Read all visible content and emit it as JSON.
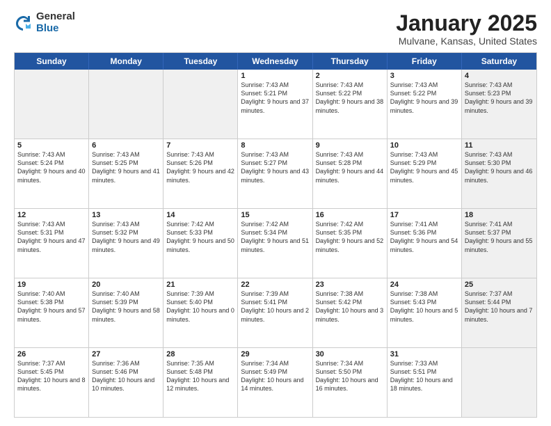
{
  "logo": {
    "general": "General",
    "blue": "Blue"
  },
  "title": "January 2025",
  "subtitle": "Mulvane, Kansas, United States",
  "header_days": [
    "Sunday",
    "Monday",
    "Tuesday",
    "Wednesday",
    "Thursday",
    "Friday",
    "Saturday"
  ],
  "weeks": [
    [
      {
        "day": "",
        "info": "",
        "shaded": true
      },
      {
        "day": "",
        "info": "",
        "shaded": true
      },
      {
        "day": "",
        "info": "",
        "shaded": true
      },
      {
        "day": "1",
        "info": "Sunrise: 7:43 AM\nSunset: 5:21 PM\nDaylight: 9 hours and 37 minutes."
      },
      {
        "day": "2",
        "info": "Sunrise: 7:43 AM\nSunset: 5:22 PM\nDaylight: 9 hours and 38 minutes."
      },
      {
        "day": "3",
        "info": "Sunrise: 7:43 AM\nSunset: 5:22 PM\nDaylight: 9 hours and 39 minutes."
      },
      {
        "day": "4",
        "info": "Sunrise: 7:43 AM\nSunset: 5:23 PM\nDaylight: 9 hours and 39 minutes.",
        "shaded": true
      }
    ],
    [
      {
        "day": "5",
        "info": "Sunrise: 7:43 AM\nSunset: 5:24 PM\nDaylight: 9 hours and 40 minutes."
      },
      {
        "day": "6",
        "info": "Sunrise: 7:43 AM\nSunset: 5:25 PM\nDaylight: 9 hours and 41 minutes."
      },
      {
        "day": "7",
        "info": "Sunrise: 7:43 AM\nSunset: 5:26 PM\nDaylight: 9 hours and 42 minutes."
      },
      {
        "day": "8",
        "info": "Sunrise: 7:43 AM\nSunset: 5:27 PM\nDaylight: 9 hours and 43 minutes."
      },
      {
        "day": "9",
        "info": "Sunrise: 7:43 AM\nSunset: 5:28 PM\nDaylight: 9 hours and 44 minutes."
      },
      {
        "day": "10",
        "info": "Sunrise: 7:43 AM\nSunset: 5:29 PM\nDaylight: 9 hours and 45 minutes."
      },
      {
        "day": "11",
        "info": "Sunrise: 7:43 AM\nSunset: 5:30 PM\nDaylight: 9 hours and 46 minutes.",
        "shaded": true
      }
    ],
    [
      {
        "day": "12",
        "info": "Sunrise: 7:43 AM\nSunset: 5:31 PM\nDaylight: 9 hours and 47 minutes."
      },
      {
        "day": "13",
        "info": "Sunrise: 7:43 AM\nSunset: 5:32 PM\nDaylight: 9 hours and 49 minutes."
      },
      {
        "day": "14",
        "info": "Sunrise: 7:42 AM\nSunset: 5:33 PM\nDaylight: 9 hours and 50 minutes."
      },
      {
        "day": "15",
        "info": "Sunrise: 7:42 AM\nSunset: 5:34 PM\nDaylight: 9 hours and 51 minutes."
      },
      {
        "day": "16",
        "info": "Sunrise: 7:42 AM\nSunset: 5:35 PM\nDaylight: 9 hours and 52 minutes."
      },
      {
        "day": "17",
        "info": "Sunrise: 7:41 AM\nSunset: 5:36 PM\nDaylight: 9 hours and 54 minutes."
      },
      {
        "day": "18",
        "info": "Sunrise: 7:41 AM\nSunset: 5:37 PM\nDaylight: 9 hours and 55 minutes.",
        "shaded": true
      }
    ],
    [
      {
        "day": "19",
        "info": "Sunrise: 7:40 AM\nSunset: 5:38 PM\nDaylight: 9 hours and 57 minutes."
      },
      {
        "day": "20",
        "info": "Sunrise: 7:40 AM\nSunset: 5:39 PM\nDaylight: 9 hours and 58 minutes."
      },
      {
        "day": "21",
        "info": "Sunrise: 7:39 AM\nSunset: 5:40 PM\nDaylight: 10 hours and 0 minutes."
      },
      {
        "day": "22",
        "info": "Sunrise: 7:39 AM\nSunset: 5:41 PM\nDaylight: 10 hours and 2 minutes."
      },
      {
        "day": "23",
        "info": "Sunrise: 7:38 AM\nSunset: 5:42 PM\nDaylight: 10 hours and 3 minutes."
      },
      {
        "day": "24",
        "info": "Sunrise: 7:38 AM\nSunset: 5:43 PM\nDaylight: 10 hours and 5 minutes."
      },
      {
        "day": "25",
        "info": "Sunrise: 7:37 AM\nSunset: 5:44 PM\nDaylight: 10 hours and 7 minutes.",
        "shaded": true
      }
    ],
    [
      {
        "day": "26",
        "info": "Sunrise: 7:37 AM\nSunset: 5:45 PM\nDaylight: 10 hours and 8 minutes."
      },
      {
        "day": "27",
        "info": "Sunrise: 7:36 AM\nSunset: 5:46 PM\nDaylight: 10 hours and 10 minutes."
      },
      {
        "day": "28",
        "info": "Sunrise: 7:35 AM\nSunset: 5:48 PM\nDaylight: 10 hours and 12 minutes."
      },
      {
        "day": "29",
        "info": "Sunrise: 7:34 AM\nSunset: 5:49 PM\nDaylight: 10 hours and 14 minutes."
      },
      {
        "day": "30",
        "info": "Sunrise: 7:34 AM\nSunset: 5:50 PM\nDaylight: 10 hours and 16 minutes."
      },
      {
        "day": "31",
        "info": "Sunrise: 7:33 AM\nSunset: 5:51 PM\nDaylight: 10 hours and 18 minutes."
      },
      {
        "day": "",
        "info": "",
        "shaded": true
      }
    ]
  ]
}
